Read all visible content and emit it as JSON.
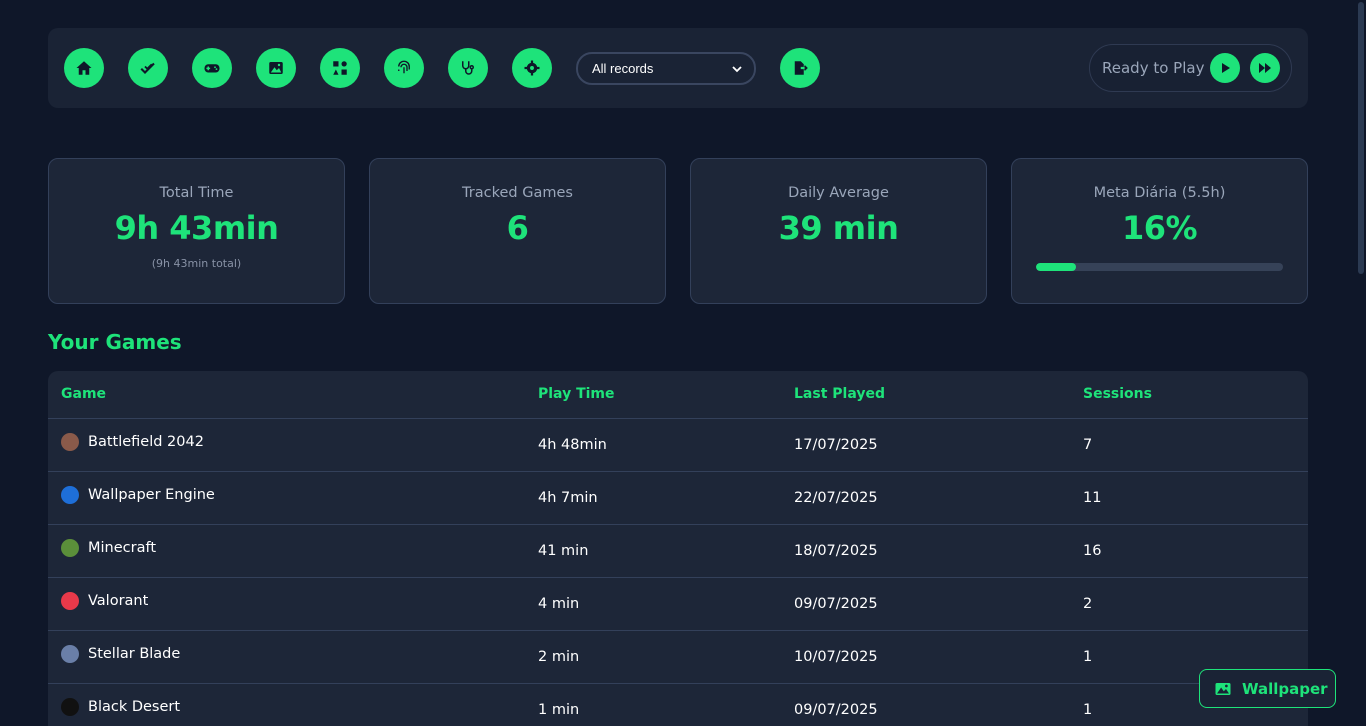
{
  "colors": {
    "accent": "#1ee37a",
    "background": "#0f1729",
    "card": "#1d2638"
  },
  "toolbar": {
    "icons": [
      "home-icon",
      "check-double-icon",
      "gamepad-icon",
      "image-icon",
      "apps-icon",
      "fingerprint-icon",
      "stethoscope-icon",
      "gear-icon"
    ],
    "filter_selected": "All records",
    "export_icon": "file-export-icon",
    "ready_text": "Ready to Play",
    "play_icon": "play-icon",
    "fast_forward_icon": "fast-forward-icon"
  },
  "stats": [
    {
      "label": "Total Time",
      "value": "9h 43min",
      "sub": "(9h 43min total)"
    },
    {
      "label": "Tracked Games",
      "value": "6"
    },
    {
      "label": "Daily Average",
      "value": "39 min"
    },
    {
      "label": "Meta Diária (5.5h)",
      "value": "16%",
      "progress": 0.16
    }
  ],
  "games_section": {
    "title": "Your Games",
    "headers": {
      "game": "Game",
      "play_time": "Play Time",
      "last_played": "Last Played",
      "sessions": "Sessions"
    },
    "rows": [
      {
        "game": "Battlefield 2042",
        "play_time": "4h 48min",
        "last_played": "17/07/2025",
        "sessions": "7",
        "icon_color": "#8a5a4a"
      },
      {
        "game": "Wallpaper Engine",
        "play_time": "4h 7min",
        "last_played": "22/07/2025",
        "sessions": "11",
        "icon_color": "#1e6fd9"
      },
      {
        "game": "Minecraft",
        "play_time": "41 min",
        "last_played": "18/07/2025",
        "sessions": "16",
        "icon_color": "#5b8f3a"
      },
      {
        "game": "Valorant",
        "play_time": "4 min",
        "last_played": "09/07/2025",
        "sessions": "2",
        "icon_color": "#e8394a"
      },
      {
        "game": "Stellar Blade",
        "play_time": "2 min",
        "last_played": "10/07/2025",
        "sessions": "1",
        "icon_color": "#6a7fa8"
      },
      {
        "game": "Black Desert",
        "play_time": "1 min",
        "last_played": "09/07/2025",
        "sessions": "1",
        "icon_color": "#111111"
      }
    ]
  },
  "wallpaper_button": {
    "label": "Wallpaper",
    "icon": "image-icon"
  }
}
